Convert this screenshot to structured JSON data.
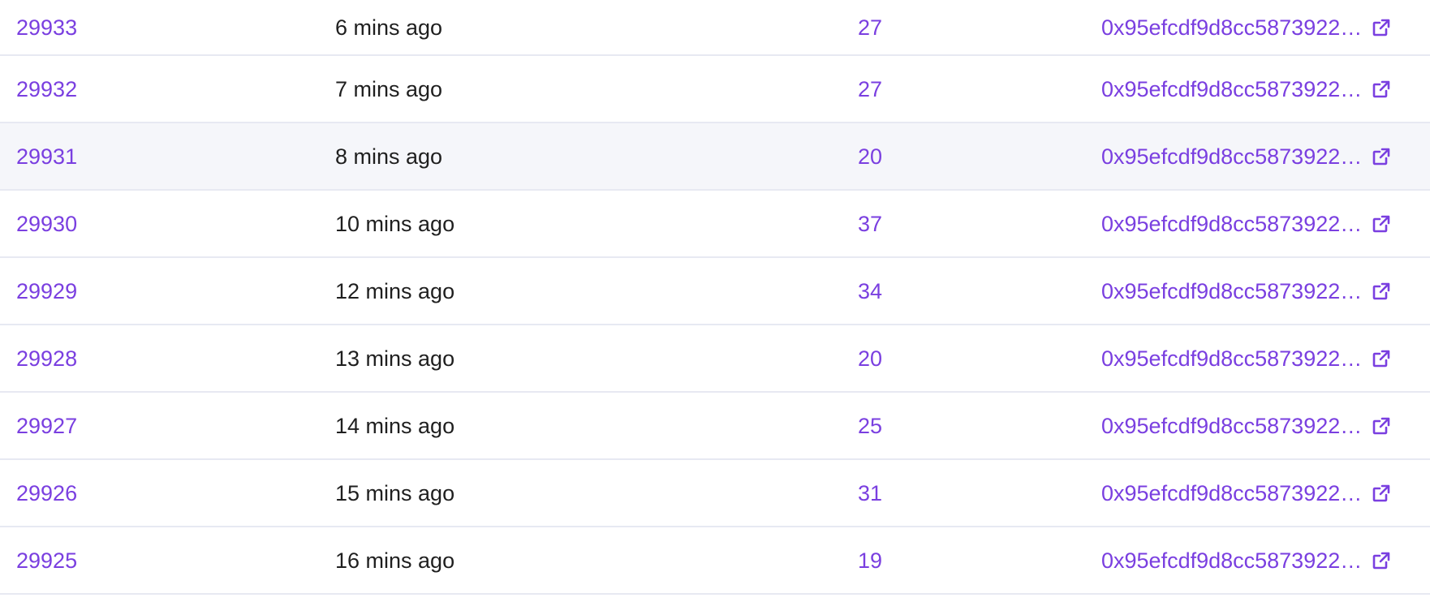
{
  "accent_color": "#7a3fe0",
  "blocks": [
    {
      "block": "29933",
      "age": "6 mins ago",
      "txns": "27",
      "miner": "0x95efcdf9d8cc5873922…",
      "hover": false
    },
    {
      "block": "29932",
      "age": "7 mins ago",
      "txns": "27",
      "miner": "0x95efcdf9d8cc5873922…",
      "hover": false
    },
    {
      "block": "29931",
      "age": "8 mins ago",
      "txns": "20",
      "miner": "0x95efcdf9d8cc5873922…",
      "hover": true
    },
    {
      "block": "29930",
      "age": "10 mins ago",
      "txns": "37",
      "miner": "0x95efcdf9d8cc5873922…",
      "hover": false
    },
    {
      "block": "29929",
      "age": "12 mins ago",
      "txns": "34",
      "miner": "0x95efcdf9d8cc5873922…",
      "hover": false
    },
    {
      "block": "29928",
      "age": "13 mins ago",
      "txns": "20",
      "miner": "0x95efcdf9d8cc5873922…",
      "hover": false
    },
    {
      "block": "29927",
      "age": "14 mins ago",
      "txns": "25",
      "miner": "0x95efcdf9d8cc5873922…",
      "hover": false
    },
    {
      "block": "29926",
      "age": "15 mins ago",
      "txns": "31",
      "miner": "0x95efcdf9d8cc5873922…",
      "hover": false
    },
    {
      "block": "29925",
      "age": "16 mins ago",
      "txns": "19",
      "miner": "0x95efcdf9d8cc5873922…",
      "hover": false
    }
  ],
  "icons": {
    "external_link": "external-link-icon"
  }
}
